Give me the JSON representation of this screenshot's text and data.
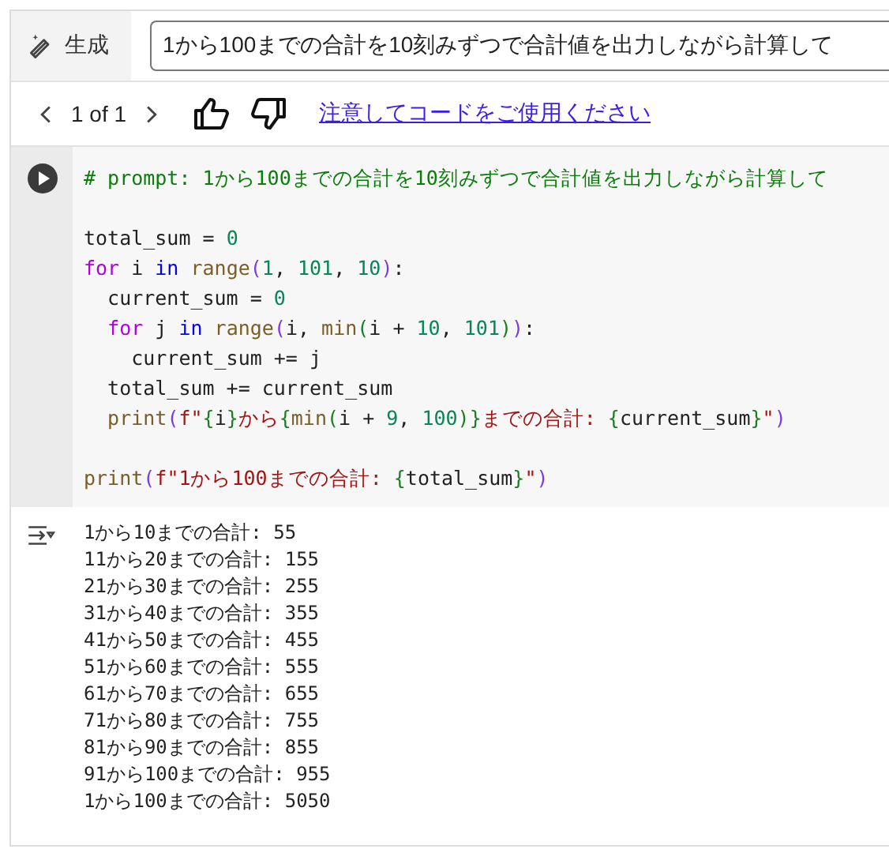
{
  "generate": {
    "label": "生成",
    "prompt": "1から100までの合計を10刻みずつで合計値を出力しながら計算して"
  },
  "pager": {
    "text": "1 of 1",
    "notice_link": "注意してコードをご使用ください"
  },
  "code_lines": [
    {
      "kind": "code",
      "tokens": [
        {
          "kind": "comment",
          "text": "# prompt: 1から100までの合計を10刻みずつで合計値を出力しながら計算して"
        }
      ]
    },
    {
      "kind": "blank"
    },
    {
      "kind": "code",
      "tokens": [
        {
          "kind": "plain",
          "text": "total_sum = "
        },
        {
          "kind": "number",
          "text": "0"
        }
      ]
    },
    {
      "kind": "code",
      "tokens": [
        {
          "kind": "keyword",
          "text": "for"
        },
        {
          "kind": "plain",
          "text": " i "
        },
        {
          "kind": "operator",
          "text": "in"
        },
        {
          "kind": "builtin",
          "text": " range"
        },
        {
          "kind": "paren",
          "text": "("
        },
        {
          "kind": "number",
          "text": "1"
        },
        {
          "kind": "plain",
          "text": ", "
        },
        {
          "kind": "number",
          "text": "101"
        },
        {
          "kind": "plain",
          "text": ", "
        },
        {
          "kind": "number",
          "text": "10"
        },
        {
          "kind": "paren",
          "text": ")"
        },
        {
          "kind": "plain",
          "text": ":"
        }
      ]
    },
    {
      "kind": "code",
      "tokens": [
        {
          "kind": "plain",
          "text": "  current_sum = "
        },
        {
          "kind": "number",
          "text": "0"
        }
      ]
    },
    {
      "kind": "code",
      "tokens": [
        {
          "kind": "keyword",
          "text": "  for"
        },
        {
          "kind": "plain",
          "text": " j "
        },
        {
          "kind": "operator",
          "text": "in"
        },
        {
          "kind": "builtin",
          "text": " range"
        },
        {
          "kind": "paren",
          "text": "("
        },
        {
          "kind": "plain",
          "text": "i, "
        },
        {
          "kind": "builtin",
          "text": "min"
        },
        {
          "kind": "paren2",
          "text": "("
        },
        {
          "kind": "plain",
          "text": "i + "
        },
        {
          "kind": "number",
          "text": "10"
        },
        {
          "kind": "plain",
          "text": ", "
        },
        {
          "kind": "number",
          "text": "101"
        },
        {
          "kind": "paren2",
          "text": ")"
        },
        {
          "kind": "paren",
          "text": ")"
        },
        {
          "kind": "plain",
          "text": ":"
        }
      ]
    },
    {
      "kind": "code",
      "tokens": [
        {
          "kind": "plain",
          "text": "    current_sum += j"
        }
      ]
    },
    {
      "kind": "code",
      "tokens": [
        {
          "kind": "plain",
          "text": "  total_sum += current_sum"
        }
      ]
    },
    {
      "kind": "code",
      "tokens": [
        {
          "kind": "builtin",
          "text": "  print"
        },
        {
          "kind": "paren",
          "text": "("
        },
        {
          "kind": "string",
          "text": "f\""
        },
        {
          "kind": "paren2",
          "text": "{"
        },
        {
          "kind": "plain",
          "text": "i"
        },
        {
          "kind": "paren2",
          "text": "}"
        },
        {
          "kind": "string",
          "text": "から"
        },
        {
          "kind": "paren2",
          "text": "{"
        },
        {
          "kind": "builtin",
          "text": "min"
        },
        {
          "kind": "paren2",
          "text": "("
        },
        {
          "kind": "plain",
          "text": "i + "
        },
        {
          "kind": "number",
          "text": "9"
        },
        {
          "kind": "plain",
          "text": ", "
        },
        {
          "kind": "number",
          "text": "100"
        },
        {
          "kind": "paren2",
          "text": ")}"
        },
        {
          "kind": "string",
          "text": "までの合計: "
        },
        {
          "kind": "paren2",
          "text": "{"
        },
        {
          "kind": "plain",
          "text": "current_sum"
        },
        {
          "kind": "paren2",
          "text": "}"
        },
        {
          "kind": "string",
          "text": "\""
        },
        {
          "kind": "paren",
          "text": ")"
        }
      ]
    },
    {
      "kind": "blank"
    },
    {
      "kind": "code",
      "tokens": [
        {
          "kind": "builtin",
          "text": "print"
        },
        {
          "kind": "paren",
          "text": "("
        },
        {
          "kind": "string",
          "text": "f\"1から100までの合計: "
        },
        {
          "kind": "paren2",
          "text": "{"
        },
        {
          "kind": "plain",
          "text": "total_sum"
        },
        {
          "kind": "paren2",
          "text": "}"
        },
        {
          "kind": "string",
          "text": "\""
        },
        {
          "kind": "paren",
          "text": ")"
        }
      ]
    }
  ],
  "output_lines": [
    "1から10までの合計: 55",
    "11から20までの合計: 155",
    "21から30までの合計: 255",
    "31から40までの合計: 355",
    "41から50までの合計: 455",
    "51から60までの合計: 555",
    "61から70までの合計: 655",
    "71から80までの合計: 755",
    "81から90までの合計: 855",
    "91から100までの合計: 955",
    "1から100までの合計: 5050"
  ]
}
